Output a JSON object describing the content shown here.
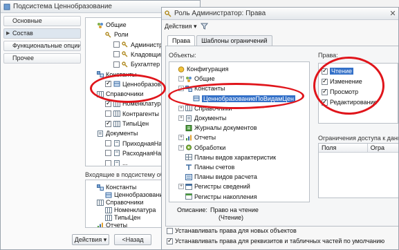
{
  "window1": {
    "title": "Подсистема Ценнобразование",
    "nav": [
      "Основные",
      "Состав",
      "Функциональные опции",
      "Прочее"
    ],
    "tree": [
      {
        "label": "Общие",
        "level": 1,
        "checked": null,
        "icon": "general-icon"
      },
      {
        "label": "Роли",
        "level": 2,
        "checked": null,
        "icon": "roles-icon"
      },
      {
        "label": "Администратор",
        "level": 3,
        "checked": false,
        "icon": "role-icon"
      },
      {
        "label": "Кладовщик",
        "level": 3,
        "checked": false,
        "icon": "role-icon"
      },
      {
        "label": "Бухгалтер",
        "level": 3,
        "checked": false,
        "icon": "role-icon"
      },
      {
        "label": "Константы",
        "level": 1,
        "checked": null,
        "icon": "constants-icon"
      },
      {
        "label": "Ценнобразование",
        "level": 2,
        "checked": true,
        "icon": "constant-icon"
      },
      {
        "label": "Справочники",
        "level": 1,
        "checked": null,
        "icon": "catalogs-icon"
      },
      {
        "label": "Номенклатура",
        "level": 2,
        "checked": true,
        "icon": "catalog-icon"
      },
      {
        "label": "Контрагенты",
        "level": 2,
        "checked": false,
        "icon": "catalog-icon"
      },
      {
        "label": "ТипыЦен",
        "level": 2,
        "checked": true,
        "icon": "catalog-icon"
      },
      {
        "label": "Документы",
        "level": 1,
        "checked": null,
        "icon": "documents-icon"
      },
      {
        "label": "ПриходнаяНакладная",
        "level": 2,
        "checked": false,
        "icon": "document-icon"
      },
      {
        "label": "РасходнаяНакладная",
        "level": 2,
        "checked": false,
        "icon": "document-icon"
      },
      {
        "label": "...",
        "level": 2,
        "checked": false,
        "icon": "document-icon"
      }
    ],
    "lower_label": "Входящие в подсистему объекты:",
    "lower_tree": [
      {
        "label": "Константы",
        "level": 1,
        "icon": "constants-icon"
      },
      {
        "label": "Ценнобразование",
        "level": 2,
        "icon": "constant-icon"
      },
      {
        "label": "Справочники",
        "level": 1,
        "icon": "catalogs-icon"
      },
      {
        "label": "Номенклатура",
        "level": 2,
        "icon": "catalog-icon"
      },
      {
        "label": "ТипыЦен",
        "level": 2,
        "icon": "catalog-icon"
      },
      {
        "label": "Отчеты",
        "level": 1,
        "icon": "reports-icon"
      }
    ],
    "buttons": {
      "actions": "Действия",
      "back": "<Назад"
    }
  },
  "window2": {
    "title": "Роль Администратор: Права",
    "toolbar": {
      "actions": "Действия"
    },
    "tabs": [
      "Права",
      "Шаблоны ограничений"
    ],
    "objects_label": "Объекты:",
    "rights_label": "Права:",
    "tree": [
      {
        "label": "Конфигурация",
        "level": 0,
        "expand": "",
        "icon": "config-icon"
      },
      {
        "label": "Общие",
        "level": 1,
        "expand": "+",
        "icon": "general-icon"
      },
      {
        "label": "Константы",
        "level": 1,
        "expand": "-",
        "icon": "constants-icon"
      },
      {
        "label": "ЦеннобразованиеПоВидамЦен",
        "level": 2,
        "expand": "",
        "icon": "constant-icon",
        "selected": true
      },
      {
        "label": "Справочники",
        "level": 1,
        "expand": "+",
        "icon": "catalogs-icon"
      },
      {
        "label": "Документы",
        "level": 1,
        "expand": "+",
        "icon": "documents-icon"
      },
      {
        "label": "Журналы документов",
        "level": 1,
        "expand": "",
        "icon": "journals-icon"
      },
      {
        "label": "Отчеты",
        "level": 1,
        "expand": "+",
        "icon": "reports-icon"
      },
      {
        "label": "Обработки",
        "level": 1,
        "expand": "+",
        "icon": "processing-icon"
      },
      {
        "label": "Планы видов характеристик",
        "level": 1,
        "expand": "",
        "icon": "chart-types-icon"
      },
      {
        "label": "Планы счетов",
        "level": 1,
        "expand": "",
        "icon": "accounts-icon"
      },
      {
        "label": "Планы видов расчета",
        "level": 1,
        "expand": "",
        "icon": "calc-types-icon"
      },
      {
        "label": "Регистры сведений",
        "level": 1,
        "expand": "+",
        "icon": "info-registers-icon"
      },
      {
        "label": "Регистры накопления",
        "level": 1,
        "expand": "",
        "icon": "accum-registers-icon"
      }
    ],
    "rights": [
      {
        "label": "Чтение",
        "checked": true,
        "selected": true
      },
      {
        "label": "Изменение",
        "checked": true,
        "selected": false
      },
      {
        "label": "Просмотр",
        "checked": true,
        "selected": false
      },
      {
        "label": "Редактирование",
        "checked": true,
        "selected": false
      }
    ],
    "restrictions_label": "Ограничения доступа к данным",
    "restrictions_columns": [
      "Поля",
      "Огра"
    ],
    "description_label": "Описание:",
    "description_text_1": "Право на чтение",
    "description_text_2": "(Чтение)",
    "checkbox_new_objects": {
      "label": "Устанавливать права для новых объектов",
      "checked": false
    },
    "checkbox_attributes": {
      "label": "Устанавливать права для реквизитов и табличных частей по умолчанию",
      "checked": true
    }
  },
  "colors": {
    "annotation": "#e0151b",
    "selection": "#3370c8"
  }
}
